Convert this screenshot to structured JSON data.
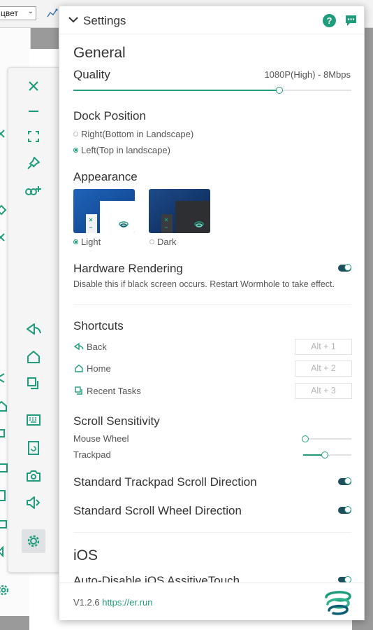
{
  "background": {
    "select_value": "цвет",
    "select_chevron": "chevron-down-icon"
  },
  "dock": {
    "items": [
      {
        "name": "close-icon"
      },
      {
        "name": "minimize-icon"
      },
      {
        "name": "fullscreen-icon"
      },
      {
        "name": "pin-icon"
      },
      {
        "name": "connect-icon"
      },
      {
        "name": "back-icon"
      },
      {
        "name": "home-icon"
      },
      {
        "name": "recent-tasks-icon"
      },
      {
        "name": "keyboard-icon"
      },
      {
        "name": "rotate-icon"
      },
      {
        "name": "camera-icon"
      },
      {
        "name": "volume-icon"
      },
      {
        "name": "settings-gear-icon"
      }
    ]
  },
  "header": {
    "title": "Settings",
    "help_label": "?"
  },
  "general": {
    "title": "General",
    "quality_label": "Quality",
    "quality_value": "1080P(High) - 8Mbps",
    "quality_level": 0.74
  },
  "dock_position": {
    "title": "Dock Position",
    "options": [
      "Right(Bottom in Landscape)",
      "Left(Top in landscape)"
    ],
    "selected": 1
  },
  "appearance": {
    "title": "Appearance",
    "options": [
      "Light",
      "Dark"
    ],
    "selected": 0
  },
  "hardware_rendering": {
    "title": "Hardware Rendering",
    "description": "Disable this if black screen occurs. Restart Wormhole to take effect.",
    "enabled": true
  },
  "shortcuts": {
    "title": "Shortcuts",
    "items": [
      {
        "label": "Back",
        "keys": "Alt + 1",
        "icon": "back-icon"
      },
      {
        "label": "Home",
        "keys": "Alt + 2",
        "icon": "home-icon"
      },
      {
        "label": "Recent Tasks",
        "keys": "Alt + 3",
        "icon": "recent-tasks-icon"
      }
    ]
  },
  "scroll_sensitivity": {
    "title": "Scroll Sensitivity",
    "mouse_wheel_label": "Mouse Wheel",
    "mouse_wheel_level": 0.05,
    "trackpad_label": "Trackpad",
    "trackpad_level": 0.45
  },
  "standard_trackpad": {
    "label": "Standard Trackpad Scroll Direction",
    "enabled": true
  },
  "standard_wheel": {
    "label": "Standard Scroll Wheel Direction",
    "enabled": true
  },
  "ios": {
    "title": "iOS",
    "auto_disable_label": "Auto-Disable iOS AssitiveTouch"
  },
  "footer": {
    "version": "V1.2.6",
    "link": "https://er.run"
  },
  "colors": {
    "accent": "#1e9c7c",
    "toggle_track": "#1f4f5c"
  }
}
